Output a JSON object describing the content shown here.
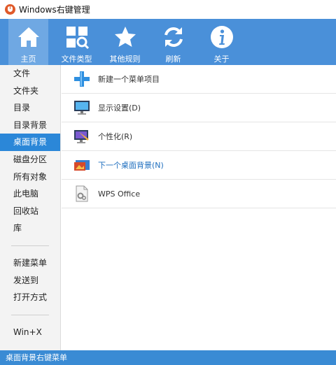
{
  "window": {
    "title": "Windows右键管理"
  },
  "toolbar": {
    "items": [
      {
        "label": "主页",
        "icon": "home-icon"
      },
      {
        "label": "文件类型",
        "icon": "file-types-icon"
      },
      {
        "label": "其他规则",
        "icon": "star-icon"
      },
      {
        "label": "刷新",
        "icon": "refresh-icon"
      },
      {
        "label": "关于",
        "icon": "info-icon"
      }
    ],
    "active_index": 0
  },
  "sidebar": {
    "group1": [
      "文件",
      "文件夹",
      "目录",
      "目录背景",
      "桌面背景",
      "磁盘分区",
      "所有对象",
      "此电脑",
      "回收站",
      "库"
    ],
    "group2": [
      "新建菜单",
      "发送到",
      "打开方式"
    ],
    "group3": [
      "Win+X"
    ],
    "selected": "桌面背景"
  },
  "main": {
    "items": [
      {
        "label": "新建一个菜单项目",
        "icon": "plus-icon"
      },
      {
        "label": "显示设置(D)",
        "icon": "monitor-icon"
      },
      {
        "label": "个性化(R)",
        "icon": "personalize-icon"
      },
      {
        "label": "下一个桌面背景(N)",
        "icon": "next-background-icon"
      },
      {
        "label": "WPS Office",
        "icon": "file-gear-icon"
      }
    ]
  },
  "status": {
    "text": "桌面背景右键菜单"
  },
  "colors": {
    "toolbar": "#4a90d9",
    "selected": "#2b87d8",
    "status": "#3a8bd4"
  }
}
